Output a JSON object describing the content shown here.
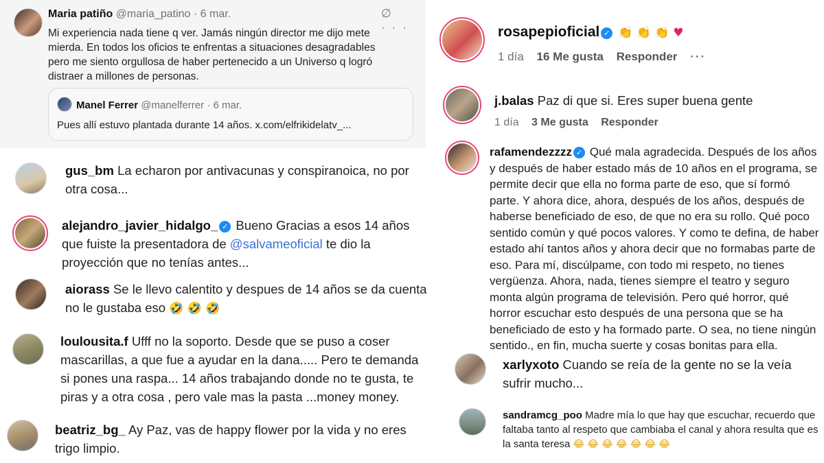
{
  "tweet": {
    "name": "Maria patiño",
    "handle": "@maria_patino",
    "date": "· 6 mar.",
    "text": "Mi experiencia nada tiene q ver. Jamás ningún director me dijo mete mierda. En todos los oficios te enfrentas a situaciones desagradables pero me siento orgullosa de haber pertenecido a un Universo q logró distraer a millones de personas.",
    "icons": [
      "grok-icon",
      "more-icon"
    ],
    "icon_glyphs": "∅ ···",
    "quote": {
      "name": "Manel Ferrer",
      "handle": "@manelferrer",
      "date": "· 6 mar.",
      "text": "Pues allí estuvo plantada durante 14 años. x.com/elfrikidelatv_..."
    }
  },
  "left_comments": [
    {
      "user": "gus_bm",
      "verified": false,
      "text": "La echaron por antivacunas y conspiranoica, no por otra cosa..."
    },
    {
      "user": "alejandro_javier_hidalgo_",
      "verified": true,
      "text_before": "Bueno Gracias a esos 14 años que fuiste la presentadora de ",
      "mention": "@salvameoficial",
      "text_after": " te dio la proyección que no tenías antes..."
    },
    {
      "user": "aiorass",
      "verified": false,
      "text": "Se le llevo calentito y despues de 14 años se da cuenta no le gustaba eso",
      "emoji": "🤣 🤣 🤣"
    },
    {
      "user": "loulousita.f",
      "verified": false,
      "text": "Ufff no la soporto. Desde que se puso a coser mascarillas, a que fue a ayudar en la dana..... Pero te demanda si pones una raspa... 14 años trabajando donde no te gusta, te piras y a otra cosa , pero vale mas la pasta ...money money."
    },
    {
      "user": "beatriz_bg_",
      "verified": false,
      "text": "Ay Paz, vas de happy flower por la vida y no eres trigo limpio."
    }
  ],
  "right_comments": [
    {
      "user": "rosapepioficial",
      "verified": true,
      "emoji": "👏 👏 👏",
      "heart": "♥",
      "time": "1 día",
      "likes": "16 Me gusta",
      "reply": "Responder",
      "more": "···"
    },
    {
      "user": "j.balas",
      "verified": false,
      "text": "Paz di que si. Eres super buena gente",
      "time": "1 día",
      "likes": "3 Me gusta",
      "reply": "Responder"
    },
    {
      "user": "rafamendezzzz",
      "verified": true,
      "text": "Qué mala agradecida. Después de los años y después de haber estado más de 10 años en el programa, se permite decir que ella no forma parte de eso, que sí formó parte. Y ahora dice, ahora, después de los años, después de haberse beneficiado de eso, de que no era su rollo. Qué poco sentido común y qué pocos valores. Y como te defina, de haber estado ahí tantos años y ahora decir que no formabas parte de eso. Para mí, discúlpame, con todo mi respeto, no tienes vergüenza. Ahora, nada, tienes siempre el teatro y seguro monta algún programa de televisión. Pero qué horror, qué horror escuchar esto después de una persona que se ha beneficiado de esto y ha formado parte. O sea, no tiene ningún sentido., en fin, mucha suerte y cosas bonitas para ella."
    },
    {
      "user": "xarlyxoto",
      "verified": false,
      "text": "Cuando se reía de la gente no se la veía sufrir mucho..."
    },
    {
      "user": "sandramcg_poo",
      "verified": false,
      "text": "Madre mía lo que hay que escuchar, recuerdo que faltaba tanto al respeto que cambiaba el canal y ahora resulta que es la santa teresa",
      "emoji": "😂 😂 😂 😂 😂 😂 😂"
    }
  ],
  "colors": {
    "mention": "#3b70d6",
    "verified": "#1d8cf2",
    "story_ring": "#e9447a",
    "tweet_bg": "#f5f5f6"
  }
}
